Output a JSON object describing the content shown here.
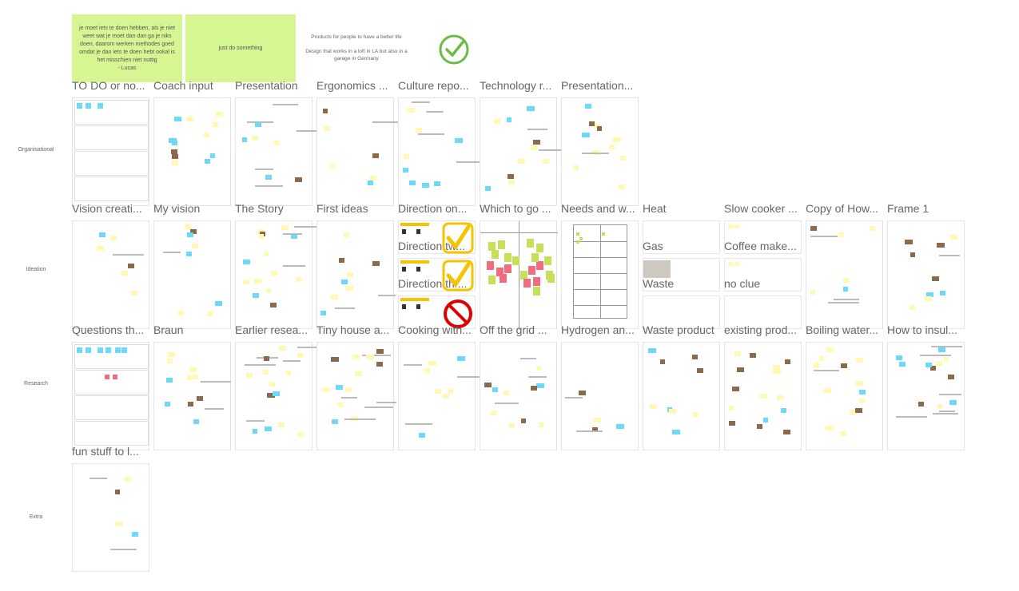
{
  "notes": [
    {
      "text": "je moet iets te doen hebben, als je niet weet wat je moet dan dan ga je niks doen, daarom werken methodes goed omdat je dan iets te doen hebt ookal is het misschien niet nuttig\n- Lucas"
    },
    {
      "text": "just do something"
    }
  ],
  "free_text": "Products for people to have a better life\n\nDesign that works in a loft in LA but also in a garage in Germany",
  "colors": {
    "sticky_green": "#d5f692",
    "sticky_yellow": "#fff9b1",
    "sticky_blue": "#6cd8fa",
    "sticky_pink": "#f16c7f",
    "check_green": "#69bd45",
    "check_yellow": "#f5c400",
    "forbid_red": "#e00000"
  },
  "rows": [
    {
      "label": "Organisational",
      "frames": [
        "TO DO or no...",
        "Coach input",
        "Presentation",
        "Ergonomics ...",
        "Culture repo...",
        "Technology r...",
        "Presentation..."
      ]
    },
    {
      "label": "Ideation",
      "frames": [
        "Vision creati...",
        "My vision",
        "The Story",
        "First ideas",
        "Direction on...",
        "Which to go ...",
        "Needs and w...",
        "Heat",
        "Slow cooker ...",
        "Copy of How...",
        "Frame 1"
      ]
    },
    {
      "label": "Research",
      "frames": [
        "Questions th...",
        "Braun",
        "Earlier resea...",
        "Tiny house a...",
        "Cooking with...",
        "Off the grid ...",
        "Hydrogen an...",
        "Waste product",
        "existing prod...",
        "Boiling water...",
        "How to insul..."
      ]
    },
    {
      "label": "Extra",
      "frames": [
        "fun stuff to l..."
      ]
    }
  ],
  "subframes": {
    "direction": [
      "Direction tw...",
      "Direction thr..."
    ],
    "heat": [
      "Gas",
      "Waste"
    ],
    "slow_cooker": [
      "Coffee make...",
      "no clue"
    ]
  },
  "icons": [
    "check-circle-icon",
    "check-box-icon",
    "forbidden-icon"
  ]
}
